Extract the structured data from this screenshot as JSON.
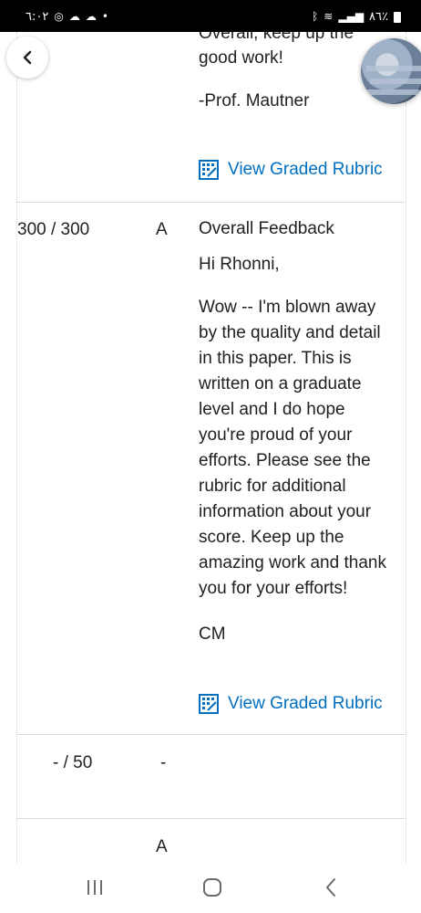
{
  "status_bar": {
    "time": "٦:٠٢",
    "battery": "٨٦٪",
    "icons": [
      "whatsapp-icon",
      "cloud-icon",
      "cloud-icon",
      "dot-icon",
      "bluetooth-icon",
      "wifi-icon",
      "signal-icon",
      "battery-icon"
    ]
  },
  "prev_feedback": {
    "line_partial": "Overall, keep up the",
    "line_2": "good work!",
    "signature": "-Prof. Mautner",
    "rubric_link": "View Graded Rubric"
  },
  "rows": [
    {
      "score": "300 / 300",
      "grade": "A",
      "feedback_title": "Overall Feedback",
      "greeting": "Hi Rhonni,",
      "body_lines": [
        "Wow -- I'm blown away",
        "by the quality and detail",
        "in this paper. This is",
        "written on a graduate",
        "level and I do hope",
        "you're proud of your",
        "efforts. Please see the",
        "rubric for additional",
        "information about your",
        "score. Keep up the",
        "amazing work and thank",
        "you for your efforts!"
      ],
      "signature": "CM",
      "rubric_link": "View Graded Rubric"
    },
    {
      "score": "- / 50",
      "grade": "-"
    },
    {
      "grade": "A"
    }
  ],
  "nav": {
    "recents": "recents-icon",
    "home": "home-icon",
    "back": "back-icon"
  }
}
